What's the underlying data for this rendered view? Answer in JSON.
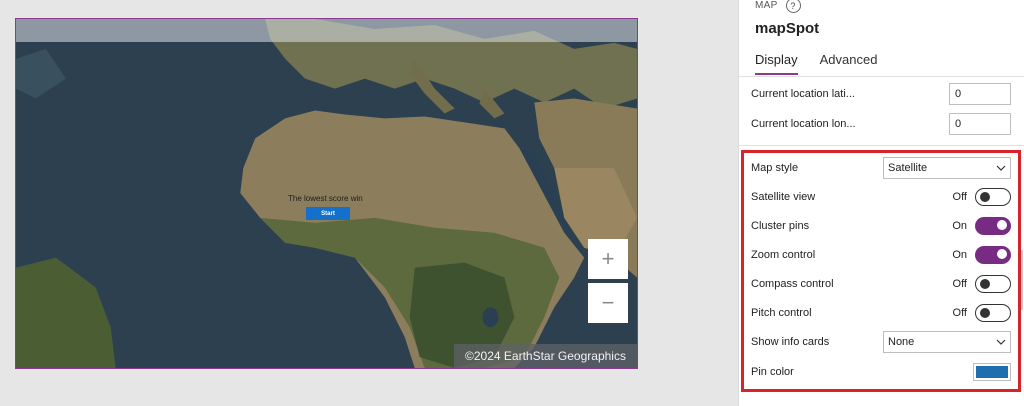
{
  "map": {
    "game_title": "The lowest score win",
    "start_label": "Start",
    "zoom_in_label": "+",
    "zoom_out_label": "−",
    "attribution": "©2024 EarthStar Geographics"
  },
  "panel": {
    "type_label": "MAP",
    "help_icon": "?",
    "control_name": "mapSpot",
    "tabs": [
      {
        "label": "Display",
        "active": true
      },
      {
        "label": "Advanced",
        "active": false
      }
    ],
    "properties": {
      "current_lat": {
        "label": "Current location lati...",
        "value": "0"
      },
      "current_lon": {
        "label": "Current location lon...",
        "value": "0"
      },
      "map_style": {
        "label": "Map style",
        "value": "Satellite"
      },
      "satellite_view": {
        "label": "Satellite view",
        "state": "Off"
      },
      "cluster_pins": {
        "label": "Cluster pins",
        "state": "On"
      },
      "zoom_control": {
        "label": "Zoom control",
        "state": "On"
      },
      "compass_control": {
        "label": "Compass control",
        "state": "Off"
      },
      "pitch_control": {
        "label": "Pitch control",
        "state": "Off"
      },
      "show_info_cards": {
        "label": "Show info cards",
        "value": "None"
      },
      "pin_color": {
        "label": "Pin color",
        "color": "#1f6fb0"
      }
    }
  },
  "colors": {
    "accent": "#772b82",
    "highlight_box": "#d8232a",
    "selection_border": "#8a3b8d"
  }
}
